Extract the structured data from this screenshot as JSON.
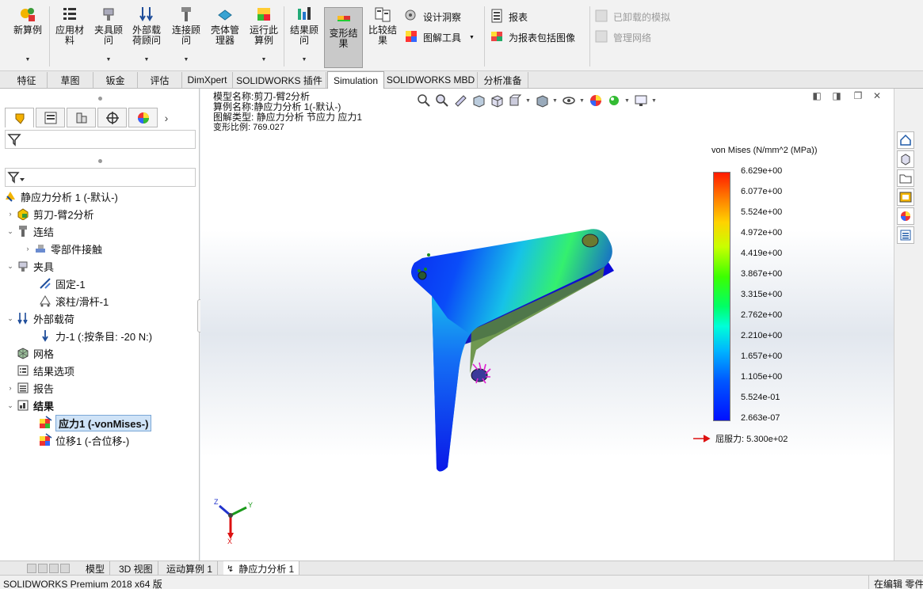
{
  "ribbon": {
    "new_study": "新算例",
    "apply_material": "应用材料",
    "fixtures": "夹具顾问",
    "external_loads": "外部载荷顾问",
    "connections": "连接顾问",
    "shell_manager": "壳体管理器",
    "run_study": "运行此算例",
    "results_advisor": "结果顾问",
    "deformed_result": "变形结果",
    "compare_results": "比较结果",
    "design_insight": "设计洞察",
    "plot_tools": "图解工具",
    "report": "报表",
    "include_image": "为报表包括图像",
    "unloaded_sims": "已卸载的模拟",
    "manage_network": "管理网络"
  },
  "tabs": [
    "特征",
    "草图",
    "钣金",
    "评估",
    "DimXpert",
    "SOLIDWORKS 插件",
    "Simulation",
    "SOLIDWORKS MBD",
    "分析准备"
  ],
  "active_tab": "Simulation",
  "tree": {
    "study": "静应力分析 1 (-默认-)",
    "part": "剪刀-臂2分析",
    "connections": "连结",
    "contact": "零部件接触",
    "fixtures": "夹具",
    "fixed": "固定-1",
    "roller": "滚柱/滑杆-1",
    "loads": "外部载荷",
    "force": "力-1 (:按条目: -20 N:)",
    "mesh": "网格",
    "result_options": "结果选项",
    "report": "报告",
    "results": "结果",
    "stress": "应力1 (-vonMises-)",
    "displacement": "位移1 (-合位移-)"
  },
  "viewport": {
    "model_name": "模型名称:剪刀-臂2分析",
    "study_name": "算例名称:静应力分析 1(-默认-)",
    "plot_type": "图解类型: 静应力分析 节应力 应力1",
    "deform_scale": "变形比例: 769.027"
  },
  "legend": {
    "title": "von Mises (N/mm^2 (MPa))",
    "ticks": [
      "6.629e+00",
      "6.077e+00",
      "5.524e+00",
      "4.972e+00",
      "4.419e+00",
      "3.867e+00",
      "3.315e+00",
      "2.762e+00",
      "2.210e+00",
      "1.657e+00",
      "1.105e+00",
      "5.524e-01",
      "2.663e-07"
    ],
    "yield": "屈服力: 5.300e+02"
  },
  "triad": {
    "x": "X",
    "y": "Y",
    "z": "Z"
  },
  "bottom_tabs": [
    "模型",
    "3D 视图",
    "运动算例 1",
    "静应力分析 1"
  ],
  "status": {
    "product": "SOLIDWORKS Premium 2018 x64 版",
    "right": "在编辑 零件"
  }
}
